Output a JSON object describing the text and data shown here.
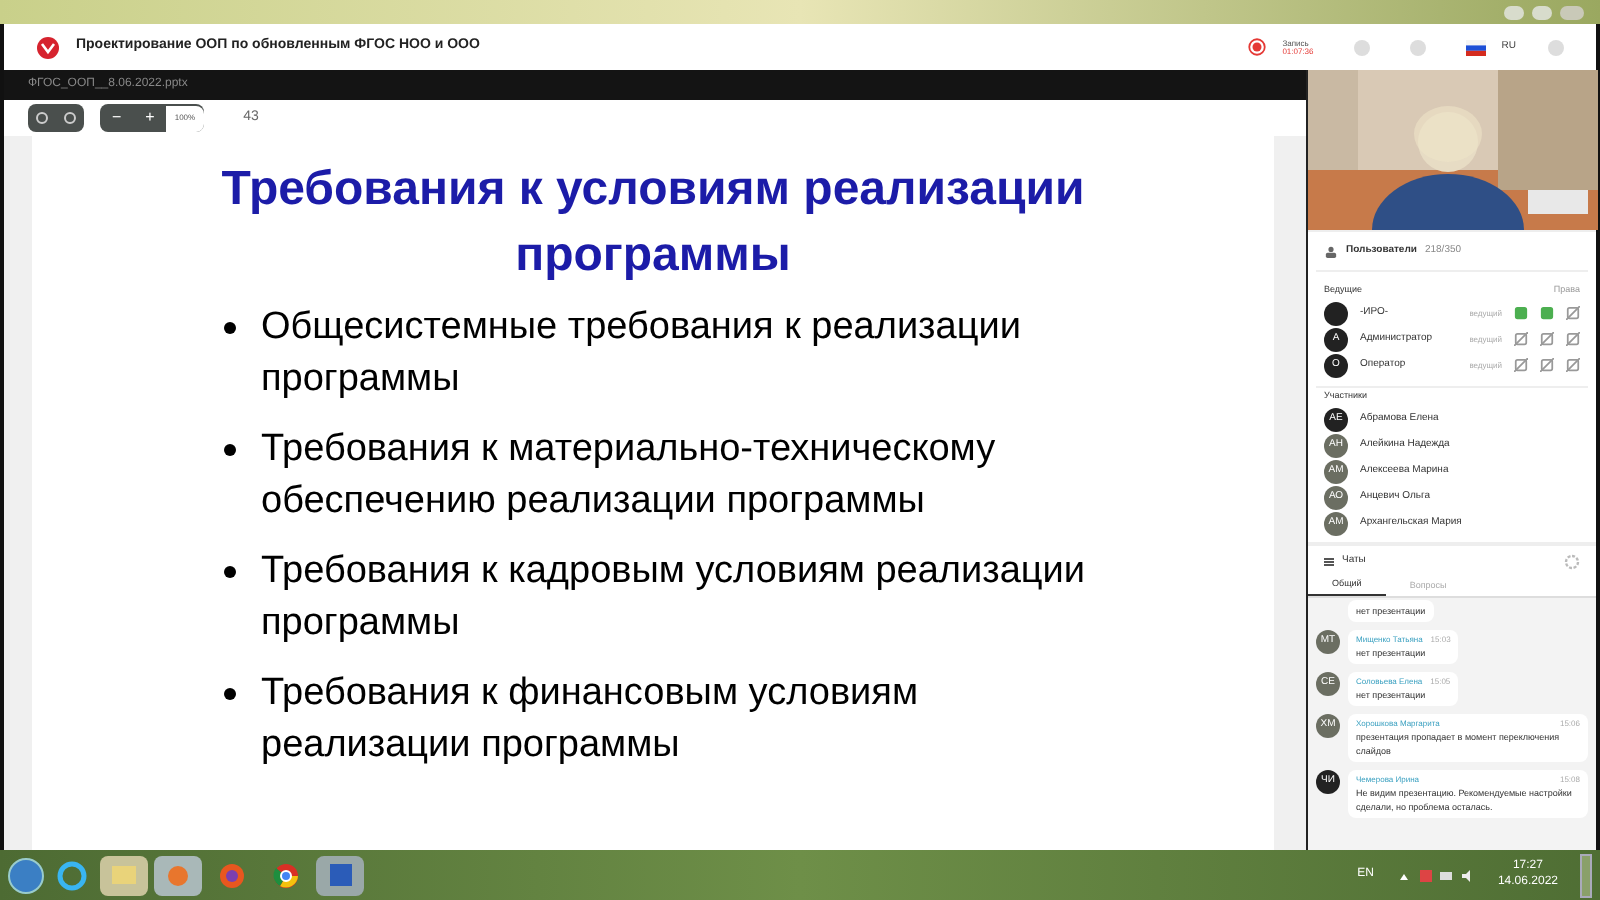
{
  "app": {
    "title": "Проектирование ООП по обновленным ФГОС НОО и ООО",
    "record_label": "Запись",
    "record_time": "01:07:36",
    "language": "RU"
  },
  "file": {
    "name": "ФГОС_ООП__8.06.2022.pptx"
  },
  "toolbar": {
    "zoom": "100%",
    "minus": "−",
    "plus": "+",
    "slide_number": "43"
  },
  "slide": {
    "title": "Требования к условиям реализации программы",
    "bullets": [
      "Общесистемные требования к реализации программы",
      "Требования к материально-техническому обеспечению реализации программы",
      "Требования к кадровым условиям реализации программы",
      "Требования к финансовым условиям реализации программы"
    ]
  },
  "users": {
    "title": "Пользователи",
    "count": "218/350",
    "hosts_label": "Ведущие",
    "rights_label": "Права",
    "hosts": [
      {
        "name": "-ИРО-",
        "role": "ведущий",
        "mic": true,
        "cam": true
      },
      {
        "initials": "А",
        "name": "Администратор",
        "role": "ведущий",
        "mic": false,
        "cam": false
      },
      {
        "initials": "О",
        "name": "Оператор",
        "role": "ведущий",
        "mic": false,
        "cam": false
      }
    ],
    "participants_label": "Участники",
    "participants": [
      {
        "initials": "АЕ",
        "name": "Абрамова Елена"
      },
      {
        "initials": "АН",
        "name": "Алейкина Надежда"
      },
      {
        "initials": "АМ",
        "name": "Алексеева Марина"
      },
      {
        "initials": "АО",
        "name": "Анцевич Ольга"
      },
      {
        "initials": "АМ",
        "name": "Архангельская Мария"
      }
    ]
  },
  "chats": {
    "title": "Чаты",
    "tabs": [
      {
        "label": "Общий",
        "selected": true
      },
      {
        "label": "Вопросы",
        "selected": false
      }
    ],
    "messages": [
      {
        "text": "нет презентации"
      },
      {
        "initials": "МТ",
        "author": "Мищенко Татьяна",
        "time": "15:03",
        "text": "нет презентации"
      },
      {
        "initials": "СЕ",
        "author": "Соловьева Елена",
        "time": "15:05",
        "text": "нет презентации"
      },
      {
        "initials": "ХМ",
        "author": "Хорошкова Маргарита",
        "time": "15:06",
        "text": "презентация пропадает в момент переключения слайдов"
      },
      {
        "initials": "ЧИ",
        "author": "Чемерова Ирина",
        "time": "15:08",
        "text": "Не видим презентацию. Рекомендуемые настройки сделали, но проблема осталась."
      }
    ]
  },
  "taskbar": {
    "language": "EN",
    "time": "17:27",
    "date": "14.06.2022"
  }
}
